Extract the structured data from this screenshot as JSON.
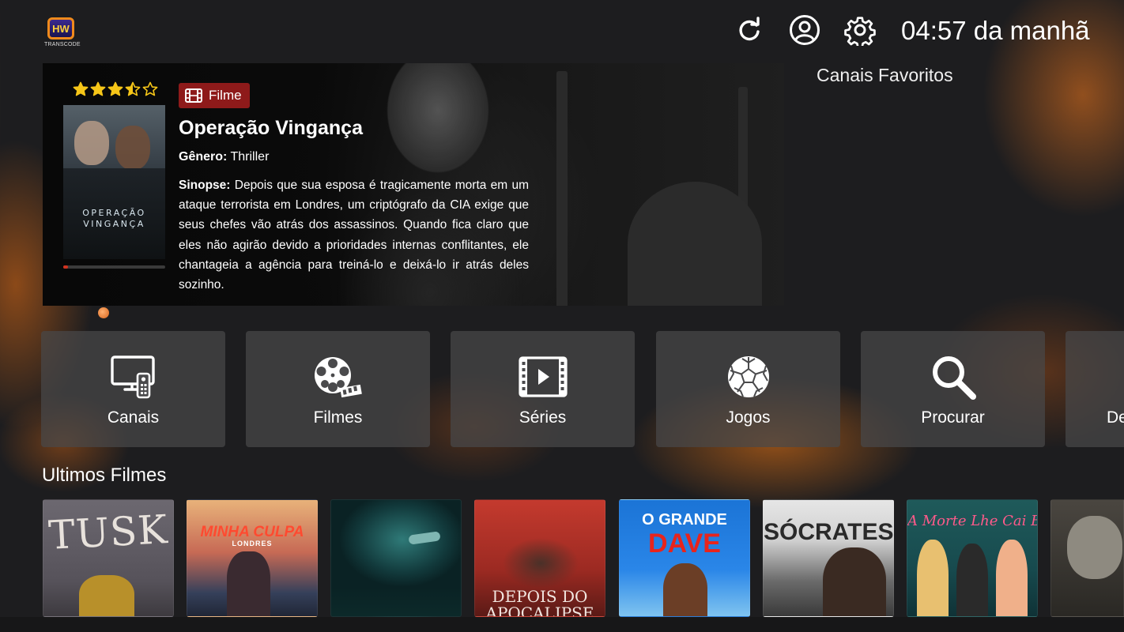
{
  "app": {
    "logo_letters": "HW",
    "logo_text": "TRANSCODE",
    "clock": "04:57 da manhã",
    "favorites_title": "Canais Favoritos",
    "header_icons": [
      "refresh-icon",
      "profile-icon",
      "settings-icon"
    ]
  },
  "featured": {
    "rating_stars": 3.5,
    "rating_max": 5,
    "badge": "Filme",
    "title": "Operação Vingança",
    "genre_label": "Gênero:",
    "genre": "Thriller",
    "synopsis_label": "Sinopse:",
    "synopsis": "Depois que sua esposa é tragicamente morta em um ataque terrorista em Londres, um criptógrafo da CIA exige que seus chefes vão atrás dos assassinos. Quando fica claro que eles não agirão devido a prioridades internas conflitantes, ele chantageia a agência para treiná-lo e deixá-lo ir atrás deles sozinho.",
    "poster_title_line1": "OPERAÇÃO",
    "poster_title_line2": "VINGANÇA",
    "progress_fraction": 0.05
  },
  "categories": [
    {
      "label": "Canais",
      "icon": "tv-icon"
    },
    {
      "label": "Filmes",
      "icon": "film-reel-icon"
    },
    {
      "label": "Séries",
      "icon": "series-icon"
    },
    {
      "label": "Jogos",
      "icon": "soccer-ball-icon"
    },
    {
      "label": "Procurar",
      "icon": "search-icon"
    },
    {
      "label": "De",
      "icon": ""
    }
  ],
  "latest_movies": {
    "title": "Ultimos Filmes",
    "items": [
      {
        "poster_text": "TUSK"
      },
      {
        "poster_text": "MINHA CULPA",
        "poster_subtext": "LONDRES"
      },
      {
        "poster_text": ""
      },
      {
        "poster_text": "DEPOIS DO",
        "poster_subtext": "APOCALIPSE"
      },
      {
        "poster_text": "O GRANDE",
        "poster_subtext": "DAVE"
      },
      {
        "poster_text": "SÓCRATES"
      },
      {
        "poster_text": "A Morte Lhe Cai Bem"
      },
      {
        "poster_text": ""
      }
    ]
  }
}
